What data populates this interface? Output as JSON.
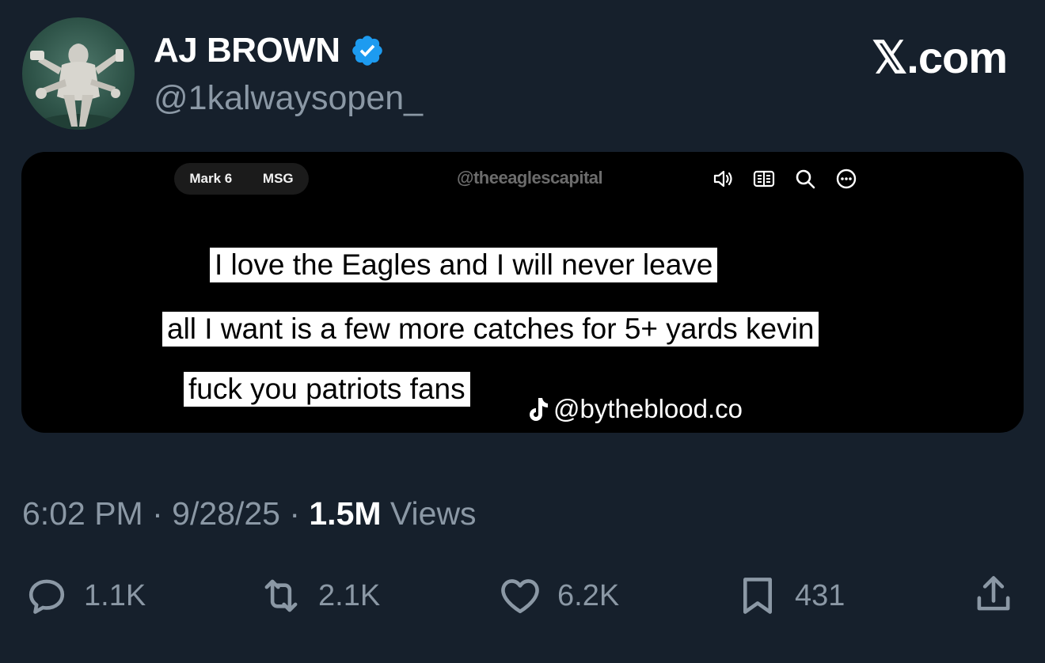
{
  "header": {
    "name": "AJ BROWN",
    "handle": "@1kalwaysopen_",
    "brand": "𝕏.com"
  },
  "media": {
    "chips": [
      "Mark 6",
      "MSG"
    ],
    "watermark": "@theeaglescapital",
    "icons": [
      "speaker-icon",
      "reader-icon",
      "search-icon",
      "more-icon"
    ],
    "captions": [
      "I love the Eagles and I will never leave",
      "all I want is a few more catches for 5+ yards kevin",
      "fuck you patriots fans"
    ],
    "tiktok_handle": "@bytheblood.co"
  },
  "meta": {
    "time": "6:02 PM",
    "separator": " · ",
    "date": "9/28/25",
    "views_count": "1.5M",
    "views_label": " Views"
  },
  "actions": {
    "replies": "1.1K",
    "reposts": "2.1K",
    "likes": "6.2K",
    "bookmarks": "431"
  },
  "colors": {
    "background": "#16202c",
    "verified": "#1d9bf0",
    "muted": "#8b98a5"
  }
}
